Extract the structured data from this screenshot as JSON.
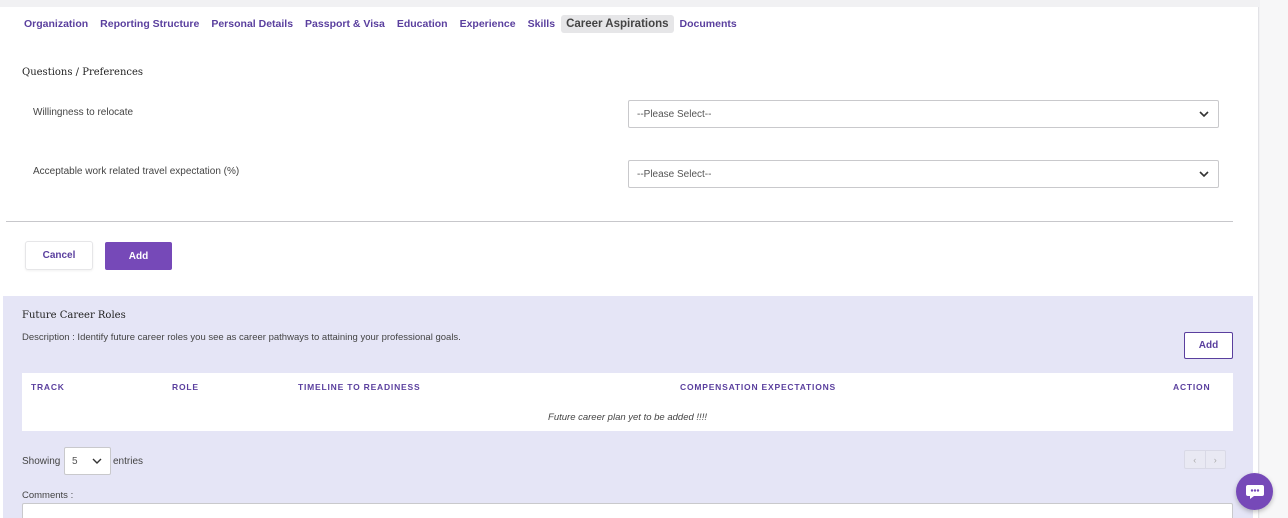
{
  "tabs": [
    {
      "label": "Organization"
    },
    {
      "label": "Reporting Structure"
    },
    {
      "label": "Personal Details"
    },
    {
      "label": "Passport & Visa"
    },
    {
      "label": "Education"
    },
    {
      "label": "Experience"
    },
    {
      "label": "Skills"
    },
    {
      "label": "Career Aspirations",
      "active": true
    },
    {
      "label": "Documents"
    }
  ],
  "preferences": {
    "title": "Questions / Preferences",
    "questions": [
      {
        "label": "Willingness to relocate",
        "selected": "--Please Select--"
      },
      {
        "label": "Acceptable work related travel expectation (%)",
        "selected": "--Please Select--"
      }
    ],
    "cancel_label": "Cancel",
    "add_label": "Add"
  },
  "future_roles": {
    "title": "Future Career Roles",
    "description": "Description : Identify future career roles you see as career pathways to attaining your professional goals.",
    "add_label": "Add",
    "columns": [
      "TRACK",
      "ROLE",
      "TIMELINE TO READINESS",
      "COMPENSATION EXPECTATIONS",
      "ACTION"
    ],
    "empty_message": "Future career plan yet to be added !!!!",
    "showing_label": "Showing",
    "page_length": "5",
    "entries_label": "entries",
    "prev_glyph": "‹",
    "next_glyph": "›",
    "comments_label": "Comments :"
  },
  "colors": {
    "accent": "#7649b8",
    "link": "#5a3f9e",
    "panel": "#e5e5f6"
  }
}
